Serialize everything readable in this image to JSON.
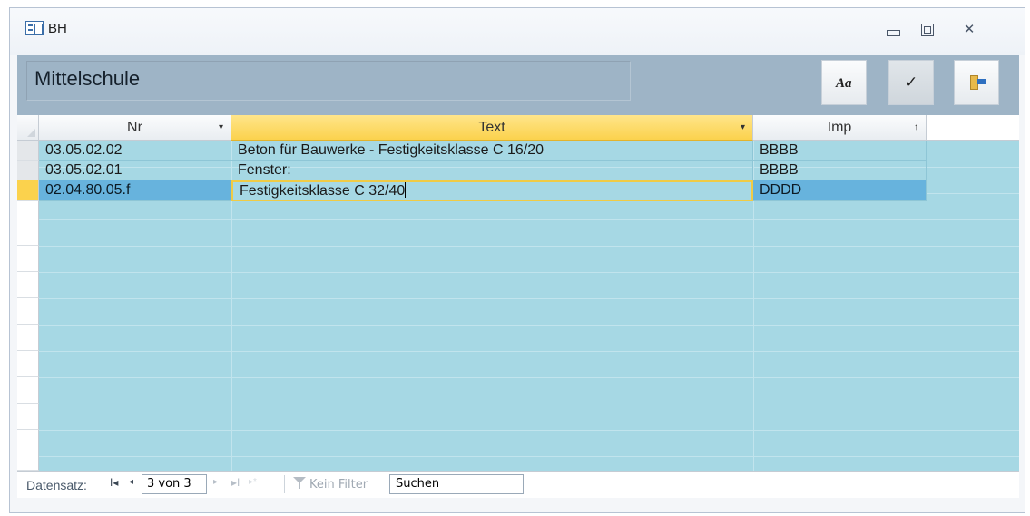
{
  "window": {
    "title": "BH"
  },
  "form": {
    "heading": "Mittelschule",
    "font_button_label": "Aa",
    "ok_button_label": "✓"
  },
  "table": {
    "columns": [
      {
        "label": "Nr",
        "indicator": "▾"
      },
      {
        "label": "Text",
        "indicator": "▾"
      },
      {
        "label": "Imp",
        "indicator": "↑"
      }
    ],
    "rows": [
      {
        "nr": "03.05.02.02",
        "text": "Beton für Bauwerke - Festigkeitsklasse C 16/20",
        "imp": "BBBB"
      },
      {
        "nr": "03.05.02.01",
        "text": "Fenster:",
        "imp": "BBBB"
      },
      {
        "nr": "02.04.80.05.f",
        "text": "Festigkeitsklasse C 32/40",
        "imp": "DDDD"
      }
    ],
    "current_row": 3
  },
  "navigation": {
    "label": "Datensatz:",
    "first": "I◂",
    "prev": "◂",
    "current": "3 von 3",
    "next": "▸",
    "last": "▸I",
    "new": "▸*",
    "filter_label": "Kein Filter",
    "search_value": "Suchen"
  },
  "colors": {
    "grid_background": "#a6d8e4",
    "header_band": "#9eb4c6",
    "active_header": "#fbd24d",
    "selected_cell": "#67b3dd"
  }
}
